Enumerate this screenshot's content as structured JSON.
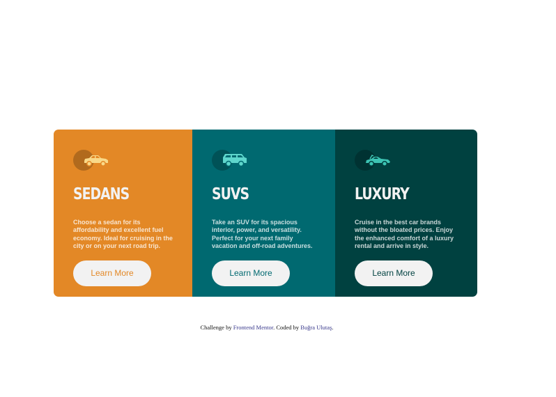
{
  "colors": {
    "sedans": "#e38826",
    "suvs": "#006970",
    "luxury": "#004140",
    "text_light": "#f2f2f2"
  },
  "cards": [
    {
      "id": "sedans",
      "icon": "sedan-car-icon",
      "title": "SEDANS",
      "text": "Choose a sedan for its affordability and excellent fuel economy. Ideal for cruising in the city or on your next road trip.",
      "button_label": "Learn More"
    },
    {
      "id": "suvs",
      "icon": "suv-car-icon",
      "title": "SUVS",
      "text": "Take an SUV for its spacious interior, power, and versatility. Perfect for your next family vacation and off-road adventures.",
      "button_label": "Learn More"
    },
    {
      "id": "luxury",
      "icon": "luxury-car-icon",
      "title": "LUXURY",
      "text": "Cruise in the best car brands without the bloated prices. Enjoy the enhanced comfort of a luxury rental and arrive in style.",
      "button_label": "Learn More"
    }
  ],
  "attribution": {
    "prefix": "Challenge by",
    "challenge_link": "Frontend Mentor",
    "middle": ". Coded by",
    "author_link": "Buğra Ulutaş",
    "suffix": "."
  }
}
